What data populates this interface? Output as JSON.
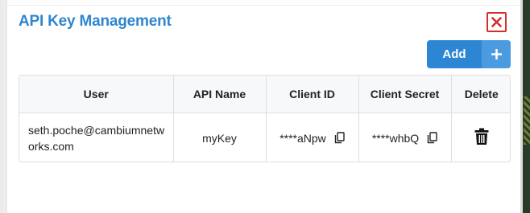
{
  "dialog": {
    "title": "API Key Management",
    "close_icon": "close-icon",
    "add_label": "Add",
    "add_icon": "plus-icon"
  },
  "table": {
    "headers": [
      "User",
      "API Name",
      "Client ID",
      "Client Secret",
      "Delete"
    ],
    "rows": [
      {
        "user": "seth.poche@cambiumnetworks.com",
        "api_name": "myKey",
        "client_id": "****aNpw",
        "client_secret": "****whbQ",
        "copy_icon": "copy-icon",
        "delete_icon": "trash-icon"
      }
    ]
  },
  "colors": {
    "title": "#2f86cf",
    "add_button": "#2d86d3",
    "close_border": "#d32f2f"
  }
}
